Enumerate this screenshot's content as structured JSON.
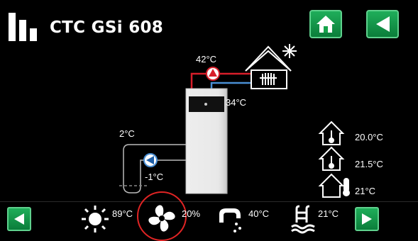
{
  "header": {
    "title": "CTC GSi 608"
  },
  "diagram": {
    "flow_temp": "42°C",
    "return_temp": "34°C",
    "brine_in_temp": "2°C",
    "brine_out_temp": "-1°C"
  },
  "rooms": [
    {
      "temp": "20.0°C"
    },
    {
      "temp": "21.5°C"
    },
    {
      "temp": "21°C"
    }
  ],
  "bottom": {
    "outdoor": "89°C",
    "fan": "20%",
    "hot_water": "40°C",
    "pool": "21°C"
  },
  "colors": {
    "accent": "#16a34a",
    "flow": "#d81e2a",
    "return": "#4a8fd4",
    "highlight": "#e02424"
  }
}
